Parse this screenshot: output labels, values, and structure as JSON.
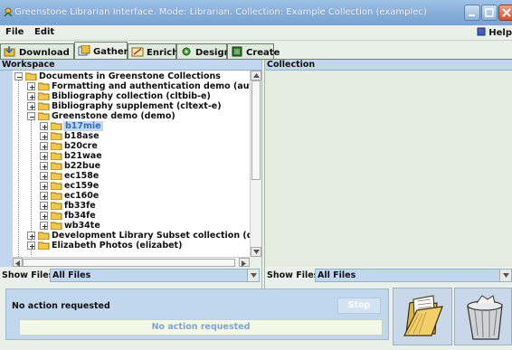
{
  "window": {
    "title": "Greenstone Librarian Interface. Mode: Librarian. Collection: Example Collection (examplec)"
  },
  "menu": {
    "file": "File",
    "edit": "Edit",
    "help": "Help"
  },
  "tabs": [
    {
      "label": "Download",
      "icon": "download-icon"
    },
    {
      "label": "Gather",
      "icon": "gather-icon",
      "active": true
    },
    {
      "label": "Enrich",
      "icon": "enrich-icon"
    },
    {
      "label": "Design",
      "icon": "design-icon"
    },
    {
      "label": "Create",
      "icon": "create-icon"
    }
  ],
  "workspace": {
    "header": "Workspace",
    "tree": [
      {
        "label": "Documents in Greenstone Collections",
        "expanded": true
      },
      {
        "label": "Formatting and authentication demo (authen-e"
      },
      {
        "label": "Bibliography collection (cltbib-e)"
      },
      {
        "label": "Bibliography supplement (cltext-e)"
      },
      {
        "label": "Greenstone demo (demo)",
        "expanded": true
      },
      {
        "label": "b17mie",
        "selected": true
      },
      {
        "label": "b18ase"
      },
      {
        "label": "b20cre"
      },
      {
        "label": "b21wae"
      },
      {
        "label": "b22bue"
      },
      {
        "label": "ec158e"
      },
      {
        "label": "ec159e"
      },
      {
        "label": "ec160e"
      },
      {
        "label": "fb33fe"
      },
      {
        "label": "fb34fe"
      },
      {
        "label": "wb34te"
      },
      {
        "label": "Development Library Subset collection (dls-e)"
      },
      {
        "label": "Elizabeth Photos (elizabet)"
      }
    ],
    "show_files_label": "Show Files",
    "show_files_value": "All Files"
  },
  "collection": {
    "header": "Collection",
    "show_files_label": "Show Files",
    "show_files_value": "All Files"
  },
  "status": {
    "message": "No action requested",
    "stop_label": "Stop",
    "progress_text": "No action requested"
  },
  "actions": {
    "open_icon": "folder-open-icon",
    "trash_icon": "trash-icon"
  }
}
